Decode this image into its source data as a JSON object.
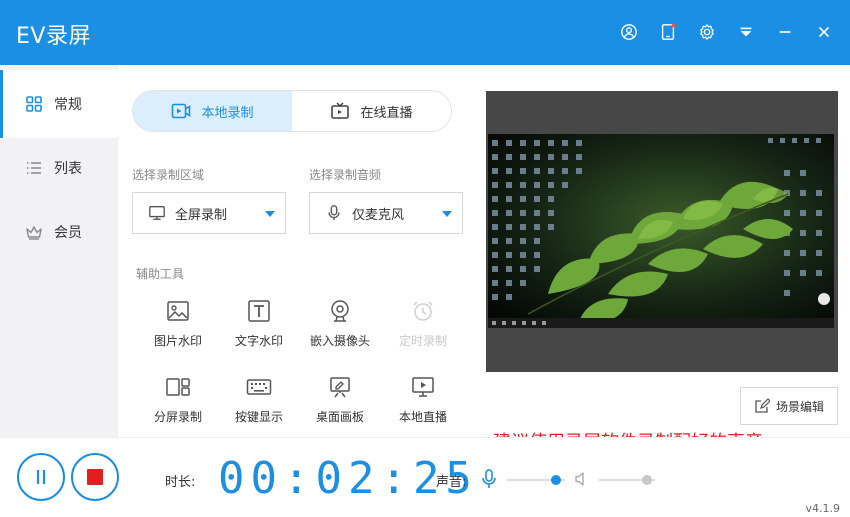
{
  "app": {
    "title": "EV录屏",
    "version": "v4.1.9"
  },
  "titlebar": {
    "icons": [
      "user-icon",
      "tablet-icon",
      "gear-icon",
      "menu-icon",
      "minimize-icon",
      "close-icon"
    ]
  },
  "sidebar": {
    "items": [
      {
        "label": "常规",
        "icon": "grid-icon",
        "active": true
      },
      {
        "label": "列表",
        "icon": "list-icon",
        "active": false
      },
      {
        "label": "会员",
        "icon": "crown-icon",
        "active": false
      }
    ]
  },
  "mode_tabs": [
    {
      "label": "本地录制",
      "icon": "video-icon",
      "active": true
    },
    {
      "label": "在线直播",
      "icon": "tv-icon",
      "active": false
    }
  ],
  "region": {
    "label": "选择录制区域",
    "value": "全屏录制"
  },
  "audio": {
    "label": "选择录制音频",
    "value": "仅麦克风"
  },
  "tools": {
    "label": "辅助工具",
    "items": [
      {
        "label": "图片水印",
        "icon": "image-icon",
        "enabled": true
      },
      {
        "label": "文字水印",
        "icon": "text-icon",
        "enabled": true
      },
      {
        "label": "嵌入摄像头",
        "icon": "webcam-icon",
        "enabled": true
      },
      {
        "label": "定时录制",
        "icon": "alarm-clock-icon",
        "enabled": false
      },
      {
        "label": "分屏录制",
        "icon": "split-screen-icon",
        "enabled": true
      },
      {
        "label": "按键显示",
        "icon": "keyboard-icon",
        "enabled": true
      },
      {
        "label": "桌面画板",
        "icon": "easel-icon",
        "enabled": true
      },
      {
        "label": "本地直播",
        "icon": "monitor-play-icon",
        "enabled": true
      }
    ]
  },
  "scene_edit": {
    "label": "场景编辑"
  },
  "bottom": {
    "duration_label": "时长:",
    "timer": "00:02:25",
    "sound_label": "声音:",
    "mic_level": 0.85,
    "speaker_level": 0.85
  },
  "annotation": "建议使用录屏软件录制配好的声音",
  "colors": {
    "accent": "#1a8fe3",
    "stop": "#e02020",
    "annotation": "#e02020"
  }
}
